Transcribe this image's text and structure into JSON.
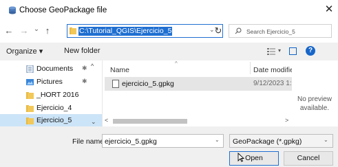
{
  "window": {
    "title": "Choose GeoPackage file",
    "close_glyph": "✕"
  },
  "nav": {
    "back_glyph": "←",
    "forward_glyph": "→",
    "recent_glyph": "⌄",
    "up_glyph": "↑"
  },
  "address": {
    "path": "C:\\Tutorial_QGIS\\Ejercicio_5",
    "dropdown_glyph": "⌄",
    "refresh_glyph": "↻"
  },
  "search": {
    "placeholder": "Search Ejercicio_5"
  },
  "toolbar": {
    "organize_label": "Organize ▾",
    "new_folder_label": "New folder",
    "view_drop_glyph": "▾",
    "help_glyph": "?"
  },
  "sidebar": {
    "items": [
      {
        "label": "Documents",
        "icon": "documents-icon",
        "pinned": true
      },
      {
        "label": "Pictures",
        "icon": "pictures-icon",
        "pinned": true
      },
      {
        "label": "_HORT 2016",
        "icon": "folder-icon",
        "pinned": false
      },
      {
        "label": "Ejercicio_4",
        "icon": "folder-icon",
        "pinned": false
      },
      {
        "label": "Ejercicio_5",
        "icon": "folder-icon",
        "pinned": false,
        "selected": true
      }
    ],
    "pin_glyph": "✱",
    "scroll_up_glyph": "^",
    "scroll_down_glyph": "⌄"
  },
  "file_list": {
    "columns": [
      "Name",
      "Date modifie"
    ],
    "sort_caret": "^",
    "files": [
      {
        "name": "ejercicio_5.gpkg",
        "date": "9/12/2023 1:2"
      }
    ],
    "hscroll_left": "<",
    "hscroll_right": ">"
  },
  "preview": {
    "text": "No preview available."
  },
  "footer": {
    "file_name_label": "File name:",
    "file_name_value": "ejercicio_5.gpkg",
    "file_type_value": "GeoPackage (*.gpkg)",
    "dropdown_glyph": "⌄",
    "open_label": "Open",
    "cancel_label": "Cancel"
  },
  "colors": {
    "accent": "#1f6fd1",
    "selection": "#cce4f7",
    "folder": "#e8b93e"
  }
}
